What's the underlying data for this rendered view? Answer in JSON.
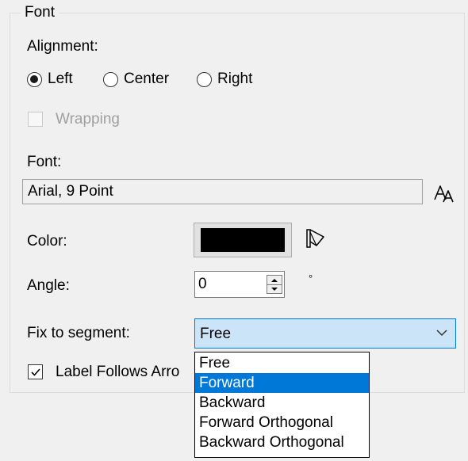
{
  "font_group": {
    "title": "Font",
    "alignment_label": "Alignment:",
    "alignment_options": [
      {
        "label": "Left",
        "checked": true
      },
      {
        "label": "Center",
        "checked": false
      },
      {
        "label": "Right",
        "checked": false
      }
    ],
    "wrapping_label": "Wrapping",
    "wrapping_enabled": false,
    "font_label": "Font:",
    "font_value": "Arial, 9 Point",
    "font_button_icon": "font-picker-icon",
    "color_label": "Color:",
    "color_value": "#000000",
    "color_button_icon": "paint-bucket-icon",
    "angle_label": "Angle:",
    "angle_value": "0",
    "angle_unit": "°",
    "fix_label": "Fix to segment:",
    "fix_value": "Free",
    "fix_options": [
      "Free",
      "Forward",
      "Backward",
      "Forward Orthogonal",
      "Backward Orthogonal"
    ],
    "fix_highlighted": "Forward",
    "label_follows_label": "Label Follows Arro",
    "label_follows_checked": true
  },
  "colors": {
    "accent": "#0078d7",
    "combo_bg": "#cce4f7",
    "window_bg": "#f0f0f0"
  }
}
